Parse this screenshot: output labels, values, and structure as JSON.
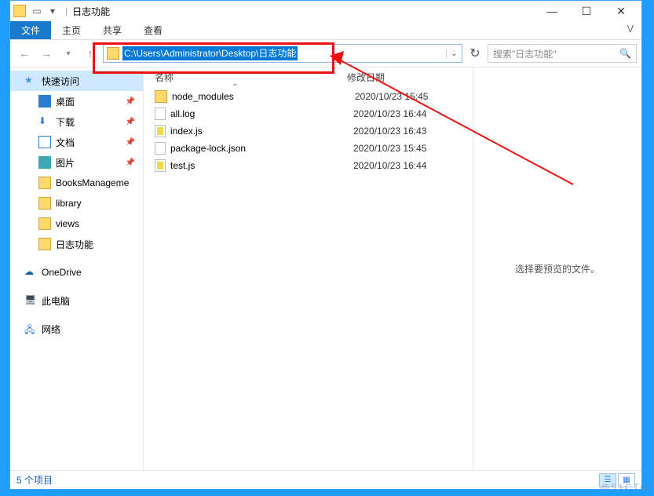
{
  "window": {
    "title": "日志功能"
  },
  "ribbon": {
    "file": "文件",
    "home": "主页",
    "share": "共享",
    "view": "查看"
  },
  "address": {
    "path": "C:\\Users\\Administrator\\Desktop\\日志功能"
  },
  "search": {
    "placeholder": "搜索\"日志功能\""
  },
  "sidebar": {
    "quick": "快速访问",
    "desktop": "桌面",
    "downloads": "下载",
    "documents": "文档",
    "pictures": "图片",
    "books": "BooksManageme",
    "library": "library",
    "views": "views",
    "logfolder": "日志功能",
    "onedrive": "OneDrive",
    "thispc": "此电脑",
    "network": "网络"
  },
  "columns": {
    "name": "名称",
    "modified": "修改日期"
  },
  "files": [
    {
      "name": "node_modules",
      "date": "2020/10/23 15:45",
      "type": "folder"
    },
    {
      "name": "all.log",
      "date": "2020/10/23 16:44",
      "type": "file"
    },
    {
      "name": "index.js",
      "date": "2020/10/23 16:43",
      "type": "js"
    },
    {
      "name": "package-lock.json",
      "date": "2020/10/23 15:45",
      "type": "file"
    },
    {
      "name": "test.js",
      "date": "2020/10/23 16:44",
      "type": "js"
    }
  ],
  "preview": {
    "empty": "选择要预览的文件。"
  },
  "status": {
    "count": "5 个项目"
  },
  "watermark": "@51CTO"
}
